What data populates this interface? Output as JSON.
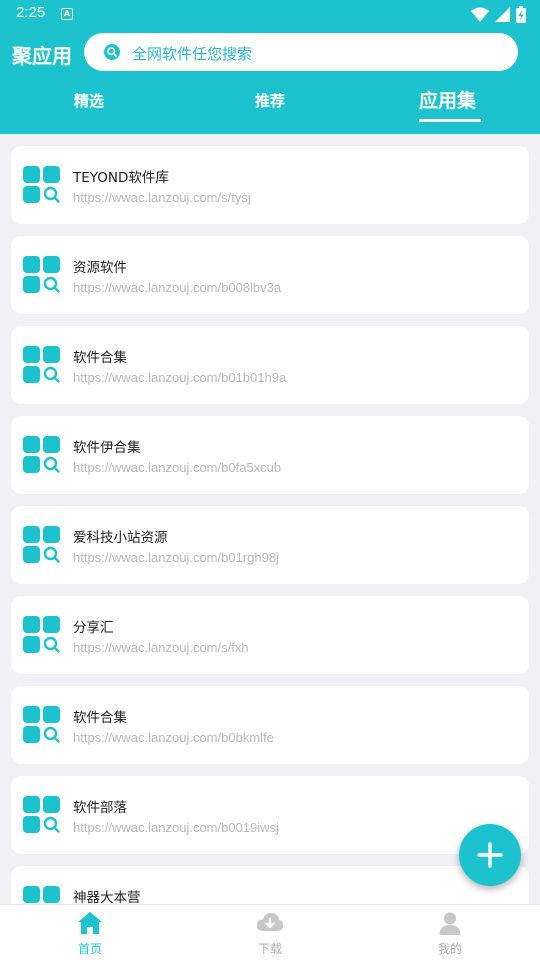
{
  "status_bar": {
    "time": "2:25",
    "notification_icon": "A",
    "icons": [
      "wifi-icon",
      "signal-icon",
      "battery-icon"
    ]
  },
  "header": {
    "app_title": "聚应用",
    "search_placeholder": "全网软件任您搜索",
    "tabs": [
      {
        "label": "精选",
        "active": false
      },
      {
        "label": "推荐",
        "active": false
      },
      {
        "label": "应用集",
        "active": true
      }
    ]
  },
  "collections": [
    {
      "name": "TEYOND软件库",
      "url": "https://wwac.lanzouj.com/s/tysj"
    },
    {
      "name": "资源软件",
      "url": "https://wwac.lanzouj.com/b008lbv3a"
    },
    {
      "name": "软件合集",
      "url": "https://wwac.lanzouj.com/b01b01h9a"
    },
    {
      "name": "软件伊合集",
      "url": "https://wwac.lanzouj.com/b0fa5xcub"
    },
    {
      "name": "爱科技小站资源",
      "url": "https://wwac.lanzouj.com/b01rgh98j"
    },
    {
      "name": "分享汇",
      "url": "https://wwac.lanzouj.com/s/fxh"
    },
    {
      "name": "软件合集",
      "url": "https://wwac.lanzouj.com/b0bkmlfe"
    },
    {
      "name": "软件部落",
      "url": "https://wwac.lanzouj.com/b0019iwsj"
    },
    {
      "name": "神器大本营",
      "url": ""
    }
  ],
  "bottom_nav": [
    {
      "label": "首页",
      "icon": "home-icon",
      "active": true
    },
    {
      "label": "下载",
      "icon": "cloud-download-icon",
      "active": false
    },
    {
      "label": "我的",
      "icon": "user-icon",
      "active": false
    }
  ],
  "colors": {
    "accent": "#1cc3cf",
    "background": "#f0f0f5",
    "url_text": "#b8b8bc",
    "inactive_nav": "#aaaaaa"
  }
}
